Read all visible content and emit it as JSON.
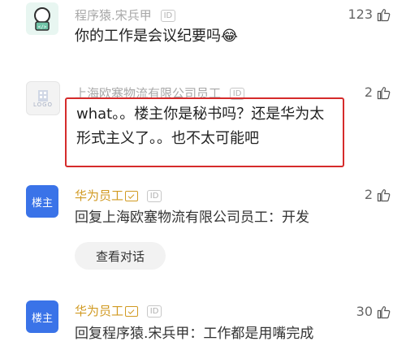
{
  "comments": [
    {
      "username": "程序猿.宋兵甲",
      "badge": "ID",
      "likes": "123",
      "text": "你的工作是会议纪要吗",
      "emoji": "😂",
      "avatar_icon": "robot-code-icon"
    },
    {
      "username": "上海欧塞物流有限公司员工",
      "badge": "ID",
      "likes": "2",
      "text_line1": "what。。楼主你是秘书吗？还是华为太",
      "text_line2": "形式主义了。。也不太可能吧",
      "avatar_label": "LOGO"
    },
    {
      "username": "华为员工",
      "badge": "ID",
      "likes": "2",
      "avatar_label": "楼主",
      "text": "回复上海欧塞物流有限公司员工：开发",
      "view_conversation": "查看对话"
    },
    {
      "username": "华为员工",
      "badge": "ID",
      "likes": "30",
      "avatar_label": "楼主",
      "text": "回复程序猿.宋兵甲：工作都是用嘴完成"
    }
  ],
  "colors": {
    "accent_host": "#d19a22",
    "host_avatar_bg": "#3a73e8",
    "highlight_border": "#d52b2b"
  }
}
